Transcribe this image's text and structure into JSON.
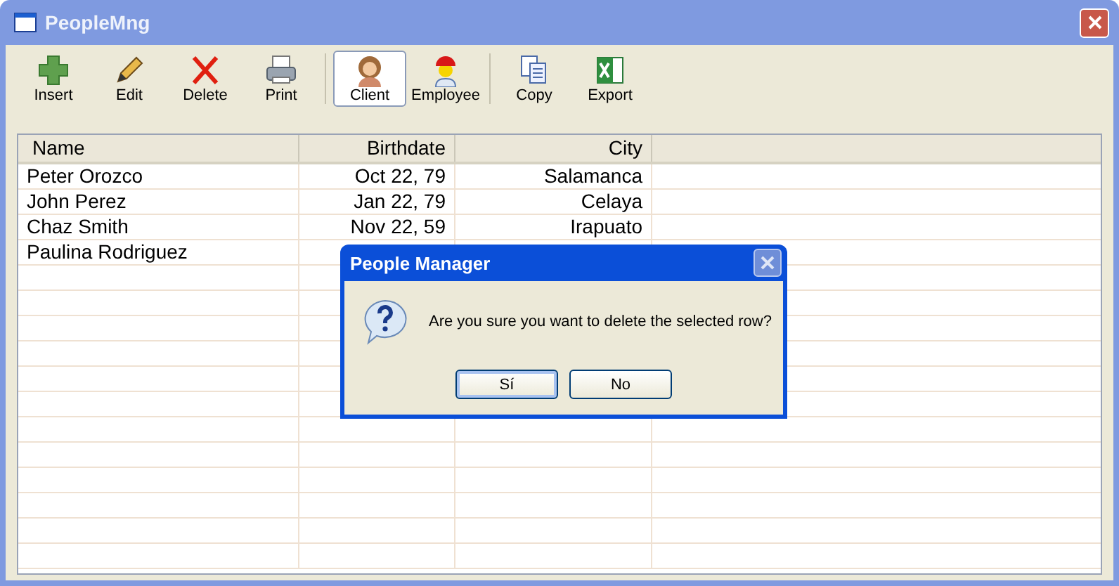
{
  "window": {
    "title": "PeopleMng"
  },
  "toolbar": {
    "groups": [
      [
        {
          "label": "Insert",
          "selected": false
        },
        {
          "label": "Edit",
          "selected": false
        },
        {
          "label": "Delete",
          "selected": false
        },
        {
          "label": "Print",
          "selected": false
        }
      ],
      [
        {
          "label": "Client",
          "selected": true
        },
        {
          "label": "Employee",
          "selected": false
        }
      ],
      [
        {
          "label": "Copy",
          "selected": false
        },
        {
          "label": "Export",
          "selected": false
        }
      ]
    ]
  },
  "table": {
    "columns": [
      "Name",
      "Birthdate",
      "City"
    ],
    "rows": [
      [
        "Peter Orozco",
        "Oct 22, 79",
        "Salamanca"
      ],
      [
        "John Perez",
        "Jan 22, 79",
        "Celaya"
      ],
      [
        "Chaz Smith",
        "Nov 22, 59",
        "Irapuato"
      ],
      [
        "Paulina Rodriguez"
      ]
    ]
  },
  "dialog": {
    "title": "People Manager",
    "message": "Are you sure you want to delete the selected row?",
    "buttons": [
      "Sí",
      "No"
    ]
  }
}
